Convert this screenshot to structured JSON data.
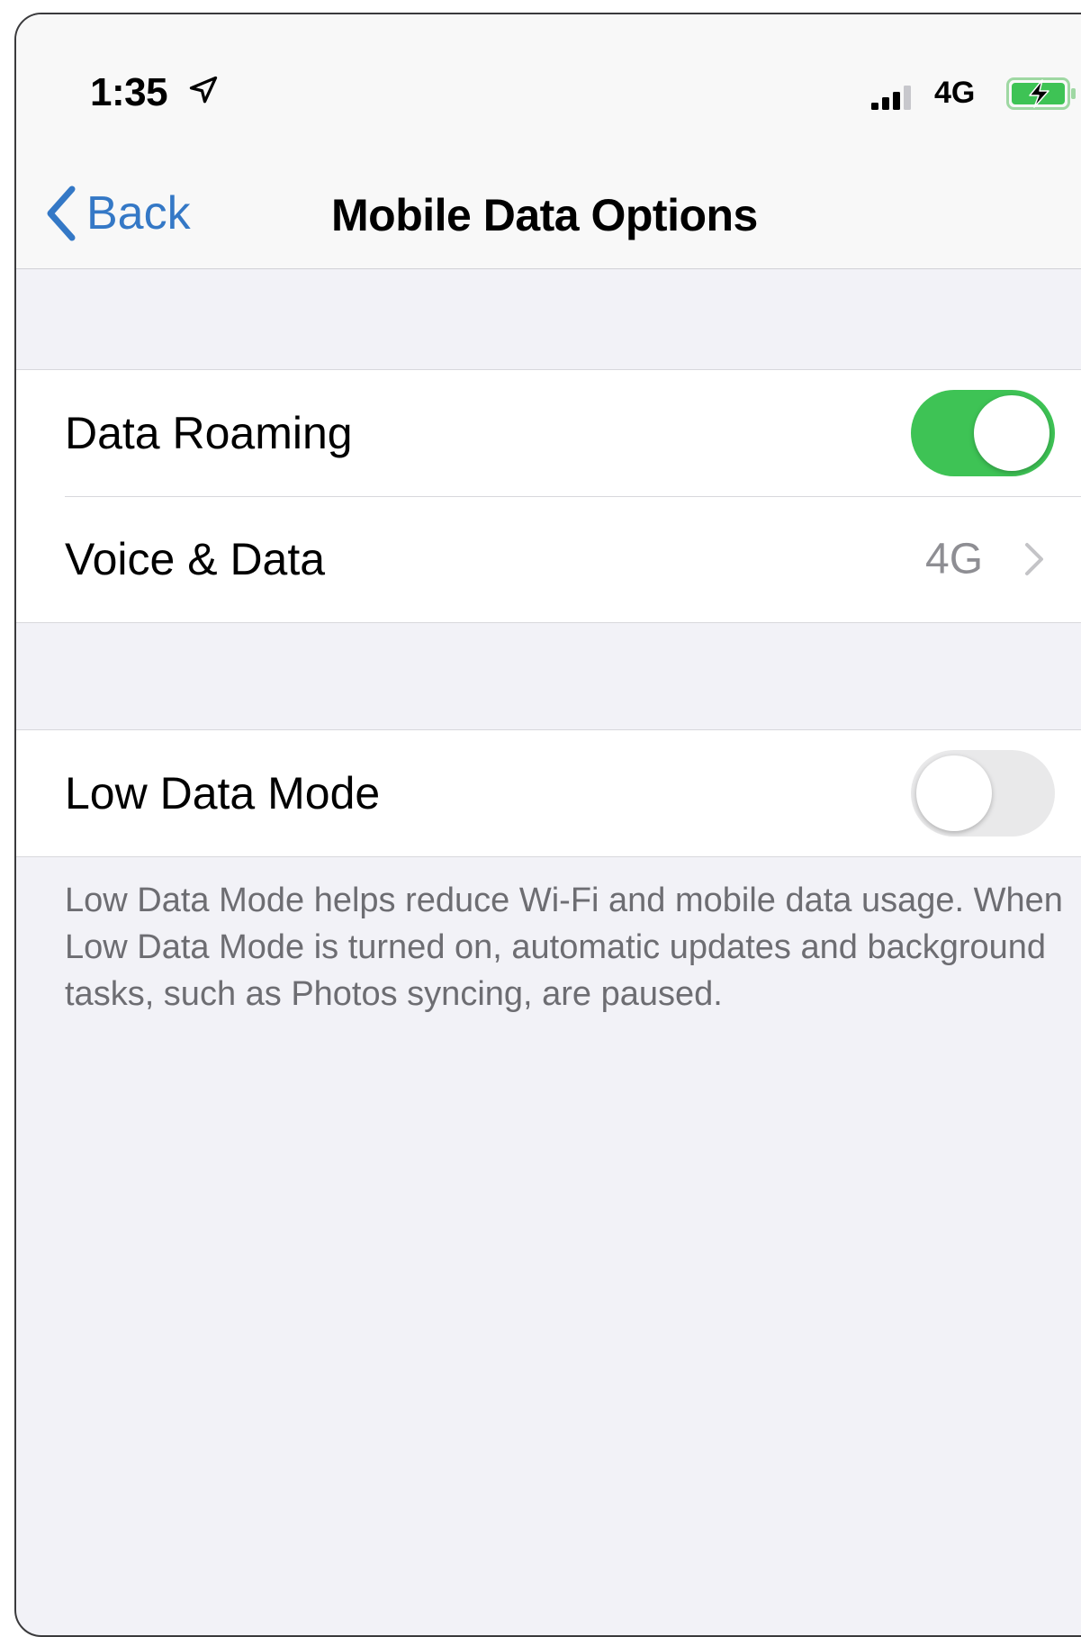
{
  "status_bar": {
    "time": "1:35",
    "location_icon": "location-arrow-icon",
    "signal_icon": "cellular-signal-icon",
    "network": "4G",
    "battery_icon": "battery-charging-icon"
  },
  "nav": {
    "back_label": "Back",
    "back_icon": "chevron-left-icon",
    "title": "Mobile Data Options"
  },
  "colors": {
    "accent": "#3478c6",
    "toggle_on": "#3ec355",
    "toggle_off": "#e9e9ea",
    "background": "#f2f2f7",
    "secondary_text": "#8e8e93"
  },
  "section1": {
    "data_roaming": {
      "label": "Data Roaming",
      "enabled": true
    },
    "voice_data": {
      "label": "Voice & Data",
      "value": "4G",
      "icon": "chevron-right-icon"
    }
  },
  "section2": {
    "low_data_mode": {
      "label": "Low Data Mode",
      "enabled": false
    },
    "footer": "Low Data Mode helps reduce Wi-Fi and mobile data usage. When Low Data Mode is turned on, automatic updates and background tasks, such as Photos syncing, are paused."
  }
}
